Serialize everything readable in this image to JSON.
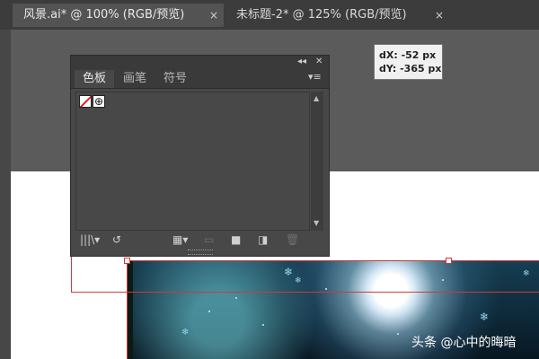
{
  "document_tabs": [
    {
      "label": "风景.ai* @ 100% (RGB/预览)",
      "active": true
    },
    {
      "label": "未标题-2* @ 125% (RGB/预览)",
      "active": false
    }
  ],
  "close_glyph": "×",
  "panel": {
    "collapse_glyph": "◂◂",
    "close_glyph": "✕",
    "menu_glyph": "▾≡",
    "tabs": [
      {
        "label": "色板",
        "active": true
      },
      {
        "label": "画笔",
        "active": false
      },
      {
        "label": "符号",
        "active": false
      }
    ],
    "swatches": [
      {
        "name": "none-swatch",
        "icon": "none-slash-icon"
      },
      {
        "name": "registration-swatch",
        "icon": "registration-target-icon",
        "glyph": "⊕"
      }
    ],
    "bottom_icons": [
      {
        "name": "swatch-libraries-icon",
        "glyph": "|||\\▾"
      },
      {
        "name": "swatch-options-icon",
        "glyph": "↺"
      },
      {
        "name": "show-swatch-kinds-icon",
        "glyph": "▦▾"
      },
      {
        "name": "swatch-options-dim-icon",
        "glyph": "▭"
      },
      {
        "name": "new-color-group-icon",
        "glyph": "■"
      },
      {
        "name": "new-swatch-icon",
        "glyph": "◨"
      },
      {
        "name": "delete-swatch-icon",
        "glyph": "🗑"
      }
    ]
  },
  "tooltip": {
    "dx": "dX: -52 px",
    "dy": "dY: -365 px"
  },
  "watermark": "头条 @心中的晦暗",
  "colors": {
    "ui_dark": "#3c3c3c",
    "pasteboard": "#5b5b5b",
    "panel_bg": "#484848",
    "selection_red": "#d03a3a"
  }
}
